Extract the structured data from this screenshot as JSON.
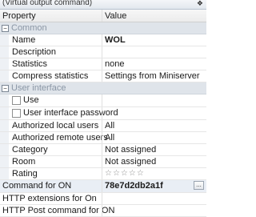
{
  "window": {
    "title": "(Virtual output command)",
    "pin_glyph": "❖"
  },
  "header": {
    "property": "Property",
    "value": "Value"
  },
  "categories": {
    "common": "Common",
    "user_interface": "User interface"
  },
  "rows": {
    "name": {
      "label": "Name",
      "value": "WOL"
    },
    "description": {
      "label": "Description",
      "value": ""
    },
    "statistics": {
      "label": "Statistics",
      "value": "none"
    },
    "compress": {
      "label": "Compress statistics",
      "value": "Settings from Miniserver"
    },
    "use": {
      "label": "Use",
      "value": ""
    },
    "uipw": {
      "label": "User interface password",
      "value": ""
    },
    "local_users": {
      "label": "Authorized local users",
      "value": "All"
    },
    "remote_users": {
      "label": "Authorized remote users",
      "value": "All"
    },
    "category": {
      "label": "Category",
      "value": "Not assigned"
    },
    "room": {
      "label": "Room",
      "value": "Not assigned"
    },
    "rating": {
      "label": "Rating",
      "stars": "☆☆☆☆☆"
    },
    "cmd_on": {
      "label": "Command for ON",
      "value": "78e7d2db2a1f",
      "button": "..."
    },
    "http_ext_on": {
      "label": "HTTP extensions for On",
      "value": ""
    },
    "http_post_on": {
      "label": "HTTP Post command for ON",
      "value": ""
    }
  },
  "colors": {
    "category_bg": "#dfe4ea",
    "category_text": "#8a96a5",
    "selected_bg": "#e9eef5"
  }
}
